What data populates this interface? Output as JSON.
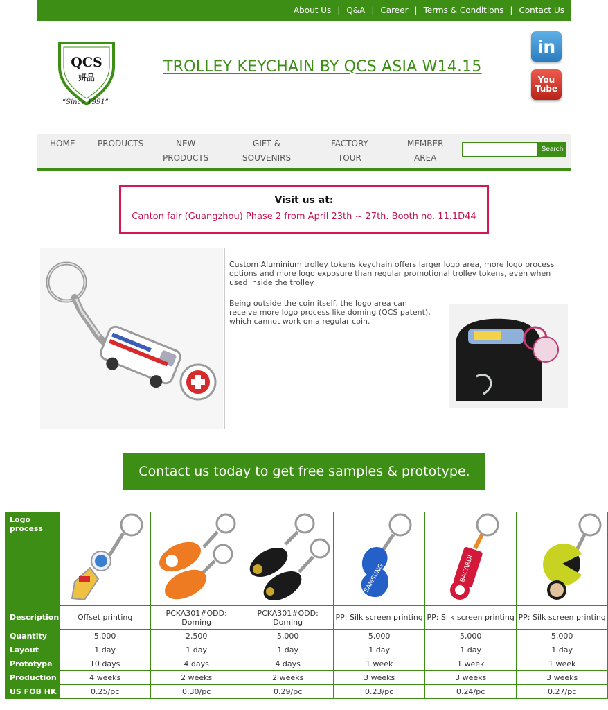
{
  "top_links": [
    "About Us",
    "Q&A",
    "Career",
    "Terms & Conditions",
    "Contact Us"
  ],
  "logo": {
    "letters": "QCS",
    "chinese": "妍品",
    "since": "“Since 1991”"
  },
  "site_title": "TROLLEY KEYCHAIN BY QCS ASIA W14.15",
  "social": {
    "linkedin": "in",
    "youtube_line1": "You",
    "youtube_line2": "Tube"
  },
  "nav": {
    "home": "HOME",
    "products": "PRODUCTS",
    "new_products_1": "NEW",
    "new_products_2": "PRODUCTS",
    "gift_1": "GIFT &",
    "gift_2": "SOUVENIRS",
    "factory_1": "FACTORY",
    "factory_2": "TOUR",
    "member_1": "MEMBER",
    "member_2": "AREA",
    "search_button": "Search"
  },
  "visit": {
    "title": "Visit us at:",
    "link": "Canton fair (Guangzhou) Phase 2 from April 23th ~ 27th. Booth no. 11.1D44"
  },
  "description": {
    "p1": "Custom Aluminium trolley tokens keychain offers larger logo area, more logo process options and more logo exposure than regular promotional trolley tokens, even when used inside the trolley.",
    "p2": "Being outside the coin itself, the logo area can receive more logo process like doming (QCS patent), which cannot work on a regular coin."
  },
  "cta": "Contact us today to get free samples & prototype.",
  "table": {
    "row_headers": {
      "logo_process": "Logo process",
      "description": "Description",
      "quantity": "Quantity",
      "layout": "Layout",
      "prototype": "Prototype",
      "production": "Production",
      "fob": "US FOB HK"
    },
    "products": [
      {
        "description": "Offset printing",
        "quantity": "5,000",
        "layout": "1 day",
        "prototype": "10 days",
        "production": "4 weeks",
        "fob": "0.25/pc"
      },
      {
        "description": "PCKA301#ODD: Doming",
        "quantity": "2,500",
        "layout": "1 day",
        "prototype": "4 days",
        "production": "2 weeks",
        "fob": "0.30/pc"
      },
      {
        "description": "PCKA301#ODD: Doming",
        "quantity": "5,000",
        "layout": "1 day",
        "prototype": "4 days",
        "production": "2 weeks",
        "fob": "0.29/pc"
      },
      {
        "description": "PP: Silk screen printing",
        "quantity": "5,000",
        "layout": "1 day",
        "prototype": "1 week",
        "production": "3 weeks",
        "fob": "0.23/pc"
      },
      {
        "description": "PP: Silk screen printing",
        "quantity": "5,000",
        "layout": "1 day",
        "prototype": "1 week",
        "production": "3 weeks",
        "fob": "0.24/pc"
      },
      {
        "description": "PP: Silk screen printing",
        "quantity": "5,000",
        "layout": "1 day",
        "prototype": "1 week",
        "production": "3 weeks",
        "fob": "0.27/pc"
      }
    ],
    "image_labels": [
      "SAMSUNG",
      "BACARDI"
    ]
  },
  "colors": {
    "brand_green": "#3c8f14",
    "accent_red": "#d3194f"
  }
}
